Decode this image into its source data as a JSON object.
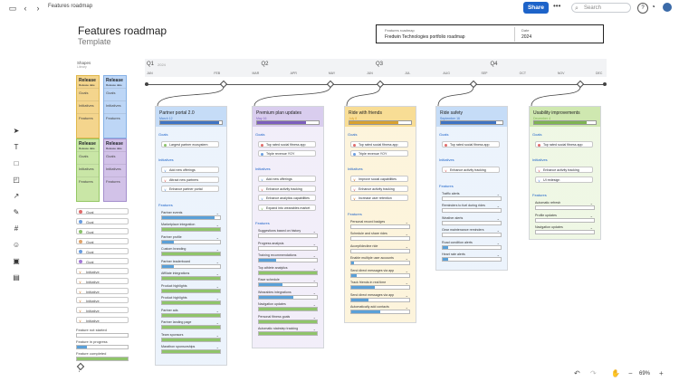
{
  "toolbar": {
    "breadcrumb": "Features roadmap",
    "share_label": "Share",
    "search_placeholder": "Search",
    "help_label": "?"
  },
  "doc": {
    "title": "Features roadmap",
    "subtitle": "Template",
    "info_label_1": "Features roadmap",
    "info_value_1": "Fredwin Technologies portfolio roadmap",
    "info_label_2": "Date",
    "info_value_2": "2024"
  },
  "palette": {
    "title": "Shapes",
    "subtitle": "Library",
    "cards": [
      {
        "head": "Release",
        "sub": "Release date",
        "cells": [
          "Goals",
          "Initiatives",
          "Features"
        ],
        "color": "#f4d58d",
        "border": "#e0b84c"
      },
      {
        "head": "Release",
        "sub": "Release date",
        "cells": [
          "Goals",
          "Initiatives",
          "Features"
        ],
        "color": "#bdd6f6",
        "border": "#86b1e6"
      },
      {
        "head": "Release",
        "sub": "Release date",
        "cells": [
          "Goals",
          "Initiatives",
          "Features"
        ],
        "color": "#c9e6a6",
        "border": "#94c764"
      },
      {
        "head": "Release",
        "sub": "Release date",
        "cells": [
          "Goals",
          "Initiatives",
          "Features"
        ],
        "color": "#d2c2e8",
        "border": "#a48fcd"
      }
    ],
    "goal_rows": [
      "Goal",
      "Goal",
      "Goal",
      "Goal",
      "Goal",
      "Goal"
    ],
    "goal_colors": [
      "#e06a6a",
      "#6a9de0",
      "#8ac26a",
      "#e0a36a",
      "#6a9de0",
      "#a57ad8"
    ],
    "initiative_rows": [
      "Initiative",
      "Initiative",
      "Initiative",
      "Initiative",
      "Initiative",
      "Initiative"
    ],
    "status_rows": [
      {
        "label": "Feature not started",
        "progress": 0
      },
      {
        "label": "Feature in progress",
        "progress": 0.2
      },
      {
        "label": "Feature completed",
        "progress": 1
      }
    ]
  },
  "timeline": {
    "quarters": [
      "Q1",
      "Q2",
      "Q3",
      "Q4"
    ],
    "q1_suffix": "2024",
    "months": [
      "JAN",
      "FEB",
      "MAR",
      "APR",
      "MAY",
      "JUN",
      "JUL",
      "AUG",
      "SEP",
      "OCT",
      "NOV",
      "DEC"
    ]
  },
  "releases": [
    {
      "name": "Partner portal 2.0",
      "date": "March 12",
      "progress": 0.95,
      "color": "#c5dcf7",
      "bar": "#3f74c4",
      "goals": [
        {
          "text": "Largest partner ecosystem",
          "color": "#8ac26a"
        }
      ],
      "initiatives": [
        {
          "text": "Add new offerings",
          "color": "#6a9de0"
        },
        {
          "text": "Attract new partners",
          "color": "#e06a6a"
        },
        {
          "text": "Enhance partner portal",
          "color": "#6a9de0"
        }
      ],
      "features": [
        {
          "text": "Partner events",
          "progress": 0.9
        },
        {
          "text": "Marketplace integration",
          "progress": 1
        },
        {
          "text": "Partner profile",
          "progress": 0.2
        },
        {
          "text": "Custom branding",
          "progress": 1
        },
        {
          "text": "Partner leaderboard",
          "progress": 0.2
        },
        {
          "text": "Affiliate integrations",
          "progress": 1
        },
        {
          "text": "Product highlights",
          "progress": 1
        },
        {
          "text": "Product highlights",
          "progress": 1
        },
        {
          "text": "Partner ads",
          "progress": 1
        },
        {
          "text": "Partner landing page",
          "progress": 1
        },
        {
          "text": "Team sponsors",
          "progress": 1
        },
        {
          "text": "Marathon sponsorships",
          "progress": 1
        }
      ]
    },
    {
      "name": "Premium plan updates",
      "date": "May 16",
      "progress": 0.8,
      "color": "#d9cdee",
      "bar": "#7d5fbe",
      "goals": [
        {
          "text": "Top rated social fitness app",
          "color": "#e06a6a"
        },
        {
          "text": "Triple revenue YOY",
          "color": "#6a9de0"
        }
      ],
      "initiatives": [
        {
          "text": "Add new offerings",
          "color": "#6a9de0"
        },
        {
          "text": "Enhance activity tracking",
          "color": "#e06a6a"
        },
        {
          "text": "Enhance analytics capabilities",
          "color": "#6a9de0"
        },
        {
          "text": "Expand into wearables market",
          "color": "#8ac26a"
        }
      ],
      "features": [
        {
          "text": "Suggestions based on history",
          "progress": 0
        },
        {
          "text": "Progress analysis",
          "progress": 0
        },
        {
          "text": "Training recommendations",
          "progress": 0.3
        },
        {
          "text": "Top athlete analytics",
          "progress": 1
        },
        {
          "text": "Race schedule",
          "progress": 0.4
        },
        {
          "text": "Wearables integrations",
          "progress": 0.6
        },
        {
          "text": "Navigation updates",
          "progress": 1
        },
        {
          "text": "Personal fitness goals",
          "progress": 1
        },
        {
          "text": "Automatic stairstep tracking",
          "progress": 1
        }
      ]
    },
    {
      "name": "Ride with friends",
      "date": "July 8",
      "progress": 0.8,
      "color": "#f8dd95",
      "bar": "#d9a22f",
      "goals": [
        {
          "text": "Top rated social fitness app",
          "color": "#e06a6a"
        },
        {
          "text": "Triple revenue YOY",
          "color": "#6a9de0"
        }
      ],
      "initiatives": [
        {
          "text": "Improve social capabilities",
          "color": "#d97c28"
        },
        {
          "text": "Enhance activity tracking",
          "color": "#e06a6a"
        },
        {
          "text": "Increase user retention",
          "color": "#d97c28"
        }
      ],
      "features": [
        {
          "text": "Personal record badges",
          "progress": 0
        },
        {
          "text": "Schedule and share rides",
          "progress": 0
        },
        {
          "text": "Accept/decline ride",
          "progress": 0
        },
        {
          "text": "Enable multiple user accounts",
          "progress": 0.05
        },
        {
          "text": "Send direct messages via app",
          "progress": 0.1
        },
        {
          "text": "Track friends in real time",
          "progress": 0.4
        },
        {
          "text": "Send direct messages via app",
          "progress": 0.3
        },
        {
          "text": "Automatically add contacts",
          "progress": 0.5
        }
      ]
    },
    {
      "name": "Ride safety",
      "date": "September 16",
      "progress": 0.9,
      "color": "#c5dcf7",
      "bar": "#3f74c4",
      "goals": [
        {
          "text": "Top rated social fitness app",
          "color": "#e06a6a"
        }
      ],
      "initiatives": [
        {
          "text": "Enhance activity tracking",
          "color": "#e06a6a"
        }
      ],
      "features": [
        {
          "text": "Traffic alerts",
          "progress": 0
        },
        {
          "text": "Reminders to fuel during rides",
          "progress": 0
        },
        {
          "text": "Weather alerts",
          "progress": 0
        },
        {
          "text": "Gear maintenance reminders",
          "progress": 0
        },
        {
          "text": "Road condition alerts",
          "progress": 0.1
        },
        {
          "text": "Heart rate alerts",
          "progress": 0.1
        }
      ]
    },
    {
      "name": "Usability improvements",
      "date": "December 4",
      "progress": 0.85,
      "color": "#cfe8b0",
      "bar": "#7fb552",
      "goals": [
        {
          "text": "Top rated social fitness app",
          "color": "#e06a6a"
        }
      ],
      "initiatives": [
        {
          "text": "Enhance activity tracking",
          "color": "#e06a6a"
        },
        {
          "text": "UI redesign",
          "color": "#6a9de0"
        }
      ],
      "features": [
        {
          "text": "Automatic refresh",
          "progress": 0
        },
        {
          "text": "Profile updates",
          "progress": 0
        },
        {
          "text": "Navigation updates",
          "progress": 0
        }
      ]
    }
  ],
  "labels": {
    "goals": "Goals",
    "initiatives": "Initiatives",
    "features": "Features"
  },
  "zoom": "69%"
}
